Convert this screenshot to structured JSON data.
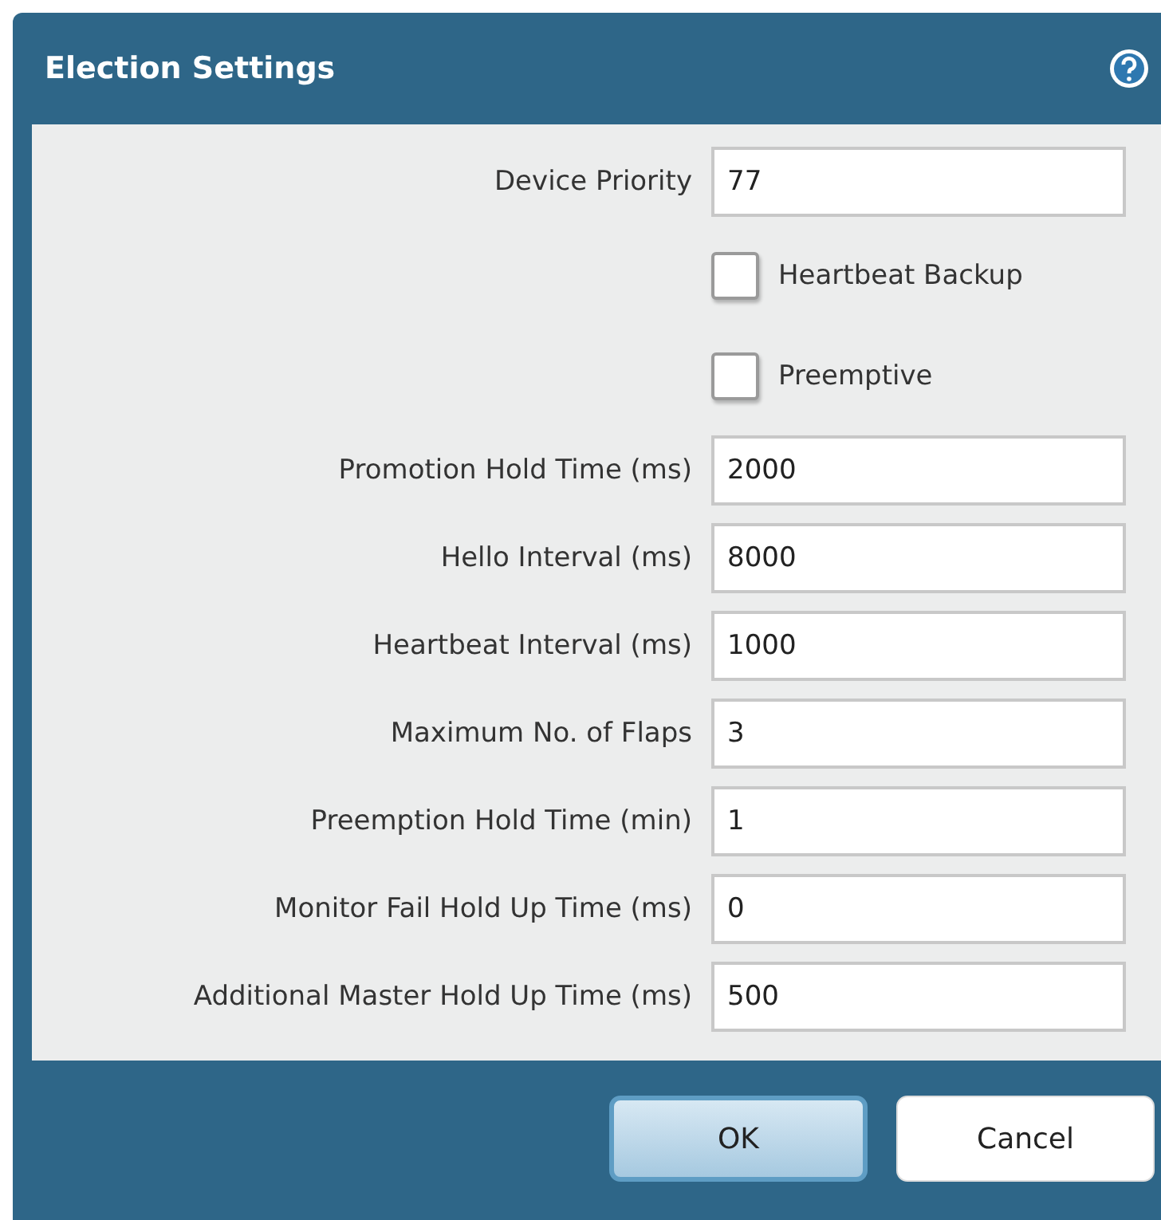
{
  "window": {
    "title": "Election Settings"
  },
  "rows": [
    {
      "kind": "field",
      "label": "Device Priority",
      "value": "77"
    },
    {
      "kind": "checkbox",
      "label": "Heartbeat Backup",
      "checked": false
    },
    {
      "kind": "checkbox",
      "label": "Preemptive",
      "checked": false
    },
    {
      "kind": "field",
      "label": "Promotion Hold Time (ms)",
      "value": "2000"
    },
    {
      "kind": "field",
      "label": "Hello Interval (ms)",
      "value": "8000"
    },
    {
      "kind": "field",
      "label": "Heartbeat Interval (ms)",
      "value": "1000"
    },
    {
      "kind": "field",
      "label": "Maximum No. of Flaps",
      "value": "3"
    },
    {
      "kind": "field",
      "label": "Preemption Hold Time (min)",
      "value": "1"
    },
    {
      "kind": "field",
      "label": "Monitor Fail Hold Up Time (ms)",
      "value": "0"
    },
    {
      "kind": "field",
      "label": "Additional Master Hold Up Time (ms)",
      "value": "500"
    }
  ],
  "buttons": [
    {
      "label": "OK",
      "kind": "primary"
    },
    {
      "label": "Cancel",
      "kind": "secondary"
    }
  ]
}
